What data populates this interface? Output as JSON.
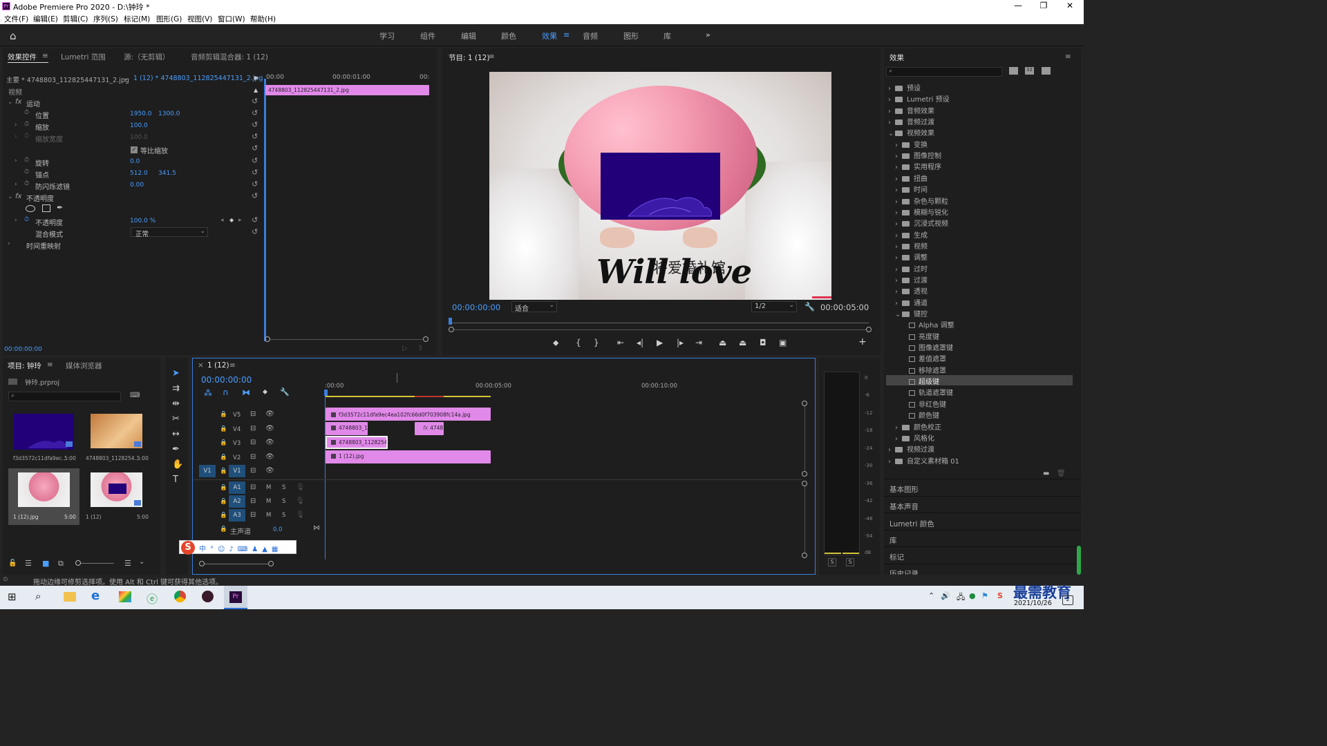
{
  "titlebar": {
    "title": "Adobe Premiere Pro 2020 - D:\\钟玲 *",
    "app_icon": "Pr"
  },
  "menu": [
    "文件(F)",
    "编辑(E)",
    "剪辑(C)",
    "序列(S)",
    "标记(M)",
    "图形(G)",
    "视图(V)",
    "窗口(W)",
    "帮助(H)"
  ],
  "workspaces": [
    "学习",
    "组件",
    "编辑",
    "颜色",
    "效果",
    "音频",
    "图形",
    "库"
  ],
  "active_workspace": "效果",
  "effect_controls": {
    "tabs": [
      "效果控件",
      "Lumetri 范围",
      "源:（无剪辑）",
      "音频剪辑混合器: 1 (12)"
    ],
    "master": "主要 * 4748803_112825447131_2.jpg",
    "sequence": "1 (12) * 4748803_112825447131_2.jpg",
    "ruler": [
      "00:00",
      "00:00:01:00",
      "00:"
    ],
    "clip_name": "4748803_112825447131_2.jpg",
    "section_video": "视频",
    "motion": "运动",
    "position_label": "位置",
    "position_x": "1950.0",
    "position_y": "1300.0",
    "scale_label": "缩放",
    "scale": "100.0",
    "scale_width_label": "缩放宽度",
    "scale_width": "100.0",
    "uniform_scale": "等比缩放",
    "rotation_label": "旋转",
    "rotation": "0.0",
    "anchor_label": "锚点",
    "anchor_x": "512.0",
    "anchor_y": "341.5",
    "flicker_label": "防闪烁滤镜",
    "flicker": "0.00",
    "opacity_group": "不透明度",
    "opacity_label": "不透明度",
    "opacity": "100.0 %",
    "blend_label": "混合模式",
    "blend": "正常",
    "time_remap": "时间重映射",
    "timecode": "00:00:00:00"
  },
  "program": {
    "tab": "节目: 1 (12)",
    "timecode": "00:00:00:00",
    "fit": "适合",
    "resolution": "1/2",
    "duration": "00:00:05:00",
    "logo_cn": "将爱婚礼馆",
    "logo_en": "Will love"
  },
  "project": {
    "tabs": [
      "项目: 钟玲",
      "媒体浏览器"
    ],
    "file": "钟玲.prproj",
    "items": [
      {
        "name": "f3d3572c11dfa9ec...",
        "dur": "5:00"
      },
      {
        "name": "4748803_1128254...",
        "dur": "5:00"
      },
      {
        "name": "1 (12).jpg",
        "dur": "5:00"
      },
      {
        "name": "1 (12)",
        "dur": "5:00"
      }
    ]
  },
  "timeline": {
    "tab": "1 (12)",
    "timecode": "00:00:00:00",
    "ruler": [
      ":00:00",
      "00:00:05:00",
      "00:00:10:00"
    ],
    "video_tracks": [
      "V5",
      "V4",
      "V3",
      "V2",
      "V1"
    ],
    "audio_tracks": [
      "A1",
      "A2",
      "A3"
    ],
    "source_patch_v": "V1",
    "master_label": "主声道",
    "master_val": "0.0",
    "clips": {
      "v5": "f3d3572c11dfa9ec4ea102fc66d0f703908fc14a.jpg",
      "v4a": "4748803_1",
      "v4b": "4748",
      "v3": "4748803_1128254",
      "v2": "1 (12).jpg"
    }
  },
  "meter": {
    "scale": [
      "0",
      "-6",
      "-12",
      "-18",
      "-24",
      "-30",
      "-36",
      "-42",
      "-48",
      "-54",
      "dB"
    ],
    "solo": [
      "S",
      "S"
    ]
  },
  "effects": {
    "title": "效果",
    "tree": [
      {
        "label": "预设",
        "level": 0,
        "kind": "folder"
      },
      {
        "label": "Lumetri 预设",
        "level": 0,
        "kind": "folder"
      },
      {
        "label": "音频效果",
        "level": 0,
        "kind": "folder"
      },
      {
        "label": "音频过渡",
        "level": 0,
        "kind": "folder"
      },
      {
        "label": "视频效果",
        "level": 0,
        "kind": "folder",
        "open": true
      },
      {
        "label": "变换",
        "level": 1,
        "kind": "folder"
      },
      {
        "label": "图像控制",
        "level": 1,
        "kind": "folder"
      },
      {
        "label": "实用程序",
        "level": 1,
        "kind": "folder"
      },
      {
        "label": "扭曲",
        "level": 1,
        "kind": "folder"
      },
      {
        "label": "时间",
        "level": 1,
        "kind": "folder"
      },
      {
        "label": "杂色与颗粒",
        "level": 1,
        "kind": "folder"
      },
      {
        "label": "模糊与锐化",
        "level": 1,
        "kind": "folder"
      },
      {
        "label": "沉浸式视频",
        "level": 1,
        "kind": "folder"
      },
      {
        "label": "生成",
        "level": 1,
        "kind": "folder"
      },
      {
        "label": "视频",
        "level": 1,
        "kind": "folder"
      },
      {
        "label": "调整",
        "level": 1,
        "kind": "folder"
      },
      {
        "label": "过时",
        "level": 1,
        "kind": "folder"
      },
      {
        "label": "过渡",
        "level": 1,
        "kind": "folder"
      },
      {
        "label": "透视",
        "level": 1,
        "kind": "folder"
      },
      {
        "label": "通道",
        "level": 1,
        "kind": "folder"
      },
      {
        "label": "键控",
        "level": 1,
        "kind": "folder",
        "open": true
      },
      {
        "label": "Alpha 调整",
        "level": 2,
        "kind": "effect"
      },
      {
        "label": "亮度键",
        "level": 2,
        "kind": "effect"
      },
      {
        "label": "图像遮罩键",
        "level": 2,
        "kind": "effect"
      },
      {
        "label": "差值遮罩",
        "level": 2,
        "kind": "effect"
      },
      {
        "label": "移除遮罩",
        "level": 2,
        "kind": "effect"
      },
      {
        "label": "超级键",
        "level": 2,
        "kind": "effect",
        "selected": true
      },
      {
        "label": "轨道遮罩键",
        "level": 2,
        "kind": "effect"
      },
      {
        "label": "非红色键",
        "level": 2,
        "kind": "effect"
      },
      {
        "label": "颜色键",
        "level": 2,
        "kind": "effect"
      },
      {
        "label": "颜色校正",
        "level": 1,
        "kind": "folder"
      },
      {
        "label": "风格化",
        "level": 1,
        "kind": "folder"
      },
      {
        "label": "视频过渡",
        "level": 0,
        "kind": "folder"
      },
      {
        "label": "自定义素材箱 01",
        "level": 0,
        "kind": "folder"
      }
    ],
    "panels": [
      "基本图形",
      "基本声音",
      "Lumetri 颜色",
      "库",
      "标记",
      "历史记录"
    ]
  },
  "status_bar": "拖动边缘可修剪选择项。使用 Alt 和 Ctrl 键可获得其他选项。",
  "taskbar": {
    "date": "2021/10/26",
    "watermark": "最需教育"
  }
}
